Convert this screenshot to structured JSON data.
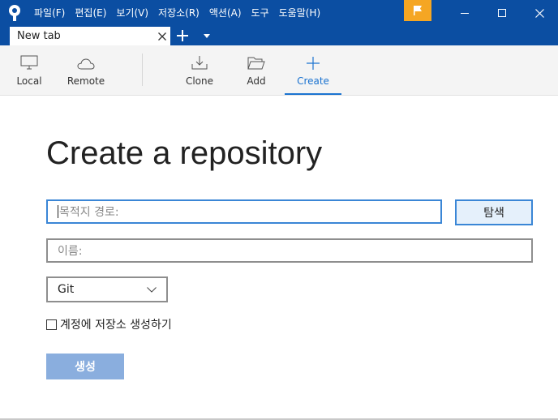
{
  "menu": {
    "items": [
      "파일(F)",
      "편집(E)",
      "보기(V)",
      "저장소(R)",
      "액션(A)",
      "도구",
      "도움말(H)"
    ]
  },
  "tabs": [
    {
      "label": "New tab"
    }
  ],
  "toolbar": {
    "local_label": "Local",
    "remote_label": "Remote",
    "clone_label": "Clone",
    "add_label": "Add",
    "create_label": "Create",
    "active": "Create"
  },
  "form": {
    "title": "Create a repository",
    "destination_placeholder": "목적지 경로:",
    "browse_label": "탐색",
    "name_placeholder": "이름:",
    "vcs_selected": "Git",
    "account_checkbox_label": "계정에 저장소 생성하기",
    "account_checkbox_checked": false,
    "create_label": "생성"
  },
  "colors": {
    "titlebar": "#0b4ea2",
    "accent": "#1b73d0",
    "flag": "#f5a623",
    "create_button": "#8aaede"
  },
  "icons": {
    "app": "sourcetree-logo",
    "flag": "flag-icon",
    "local": "monitor-icon",
    "remote": "cloud-icon",
    "clone": "download-icon",
    "add": "folder-icon",
    "create": "plus-icon"
  }
}
